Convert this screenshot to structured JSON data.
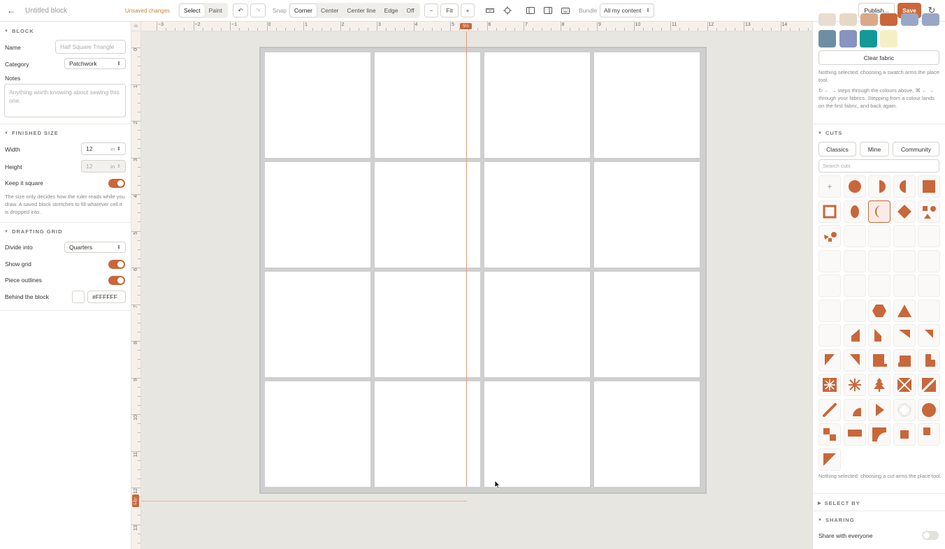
{
  "topbar": {
    "title": "Untitled block",
    "unsaved": "Unsaved changes",
    "mode": [
      "Select",
      "Paint"
    ],
    "snap_label": "Snap",
    "snap_options": [
      "Corner",
      "Center",
      "Center line",
      "Edge",
      "Off"
    ],
    "zoom_minus": "−",
    "zoom_fit": "Fit",
    "zoom_plus": "+",
    "bundle_label": "Bundle",
    "bundle_value": "All my content",
    "publish": "Publish...",
    "save": "Save",
    "accent": "#c9673a"
  },
  "block": {
    "heading": "BLOCK",
    "name_label": "Name",
    "name_placeholder": "Half Square Triangle",
    "category_label": "Category",
    "category_value": "Patchwork",
    "notes_label": "Notes",
    "notes_placeholder": "Anything worth knowing about sewing this one."
  },
  "finished": {
    "heading": "FINISHED SIZE",
    "width_label": "Width",
    "width_value": "12",
    "height_label": "Height",
    "height_value": "12",
    "unit": "in",
    "square_label": "Keep it square",
    "square_on": true,
    "help": "The size only decides how the ruler reads while you draw. A saved block stretches to fill whatever cell it is dropped into."
  },
  "grid": {
    "heading": "DRAFTING GRID",
    "divide_label": "Divide into",
    "divide_value": "Quarters",
    "show_grid_label": "Show grid",
    "show_grid_on": true,
    "outlines_label": "Piece outlines",
    "outlines_on": true,
    "behind_label": "Behind the block",
    "behind_value": "#FFFFFF"
  },
  "canvas": {
    "corner": "in",
    "h_ticks": [
      "−3",
      "−2",
      "−1",
      "0",
      "1",
      "2",
      "3",
      "4",
      "5",
      "6",
      "7",
      "8",
      "9",
      "10",
      "11",
      "12",
      "13",
      "14"
    ],
    "v_ticks": [
      "0",
      "1",
      "2",
      "3",
      "4",
      "5",
      "6",
      "7",
      "8",
      "9",
      "10",
      "11",
      "12",
      "13"
    ],
    "h_marker": "5½",
    "v_marker": "12½"
  },
  "fabric": {
    "swatch_colors": [
      "#6f8ea5",
      "#8893c0",
      "#139a96",
      "#f6efc6"
    ],
    "clear_label": "Clear fabric",
    "help1": "Nothing selected: choosing a swatch arms the place tool.",
    "help2": "↻ ← → steps through the colours above, ⌘ ← → through your fabrics. Stepping from a colour lands on the first fabric, and back again."
  },
  "cuts": {
    "heading": "CUTS",
    "tabs": [
      "Classics",
      "Mine",
      "Community"
    ],
    "search_placeholder": "Search cuts",
    "help": "Nothing selected: choosing a cut arms the place tool."
  },
  "select_by": {
    "heading": "SELECT BY"
  },
  "sharing": {
    "heading": "SHARING",
    "share_label": "Share with everyone",
    "share_on": false
  }
}
